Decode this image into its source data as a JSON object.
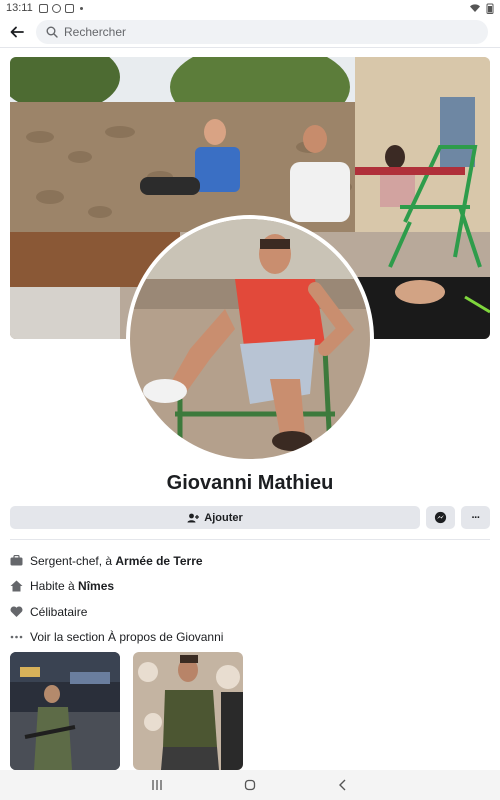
{
  "status_bar": {
    "time": "13:11"
  },
  "top_bar": {
    "back_icon": "arrow-left-icon",
    "search_placeholder": "Rechercher"
  },
  "profile": {
    "name": "Giovanni Mathieu"
  },
  "actions": {
    "add_label": "Ajouter",
    "messenger_icon": "messenger-icon",
    "more_label": "···"
  },
  "info": {
    "job_prefix": "Sergent-chef, à ",
    "job_org": "Armée de Terre",
    "home_prefix": "Habite à ",
    "home_city": "Nîmes",
    "status": "Célibataire",
    "about_link": "Voir la section À propos de Giovanni"
  },
  "nav_bar": {
    "recent_icon": "recent-apps-icon",
    "home_icon": "home-icon",
    "back_icon": "back-icon"
  },
  "colors": {
    "accent": "#1877f2",
    "button_bg": "#e4e6eb",
    "text": "#1c1e21",
    "muted": "#65676b"
  }
}
